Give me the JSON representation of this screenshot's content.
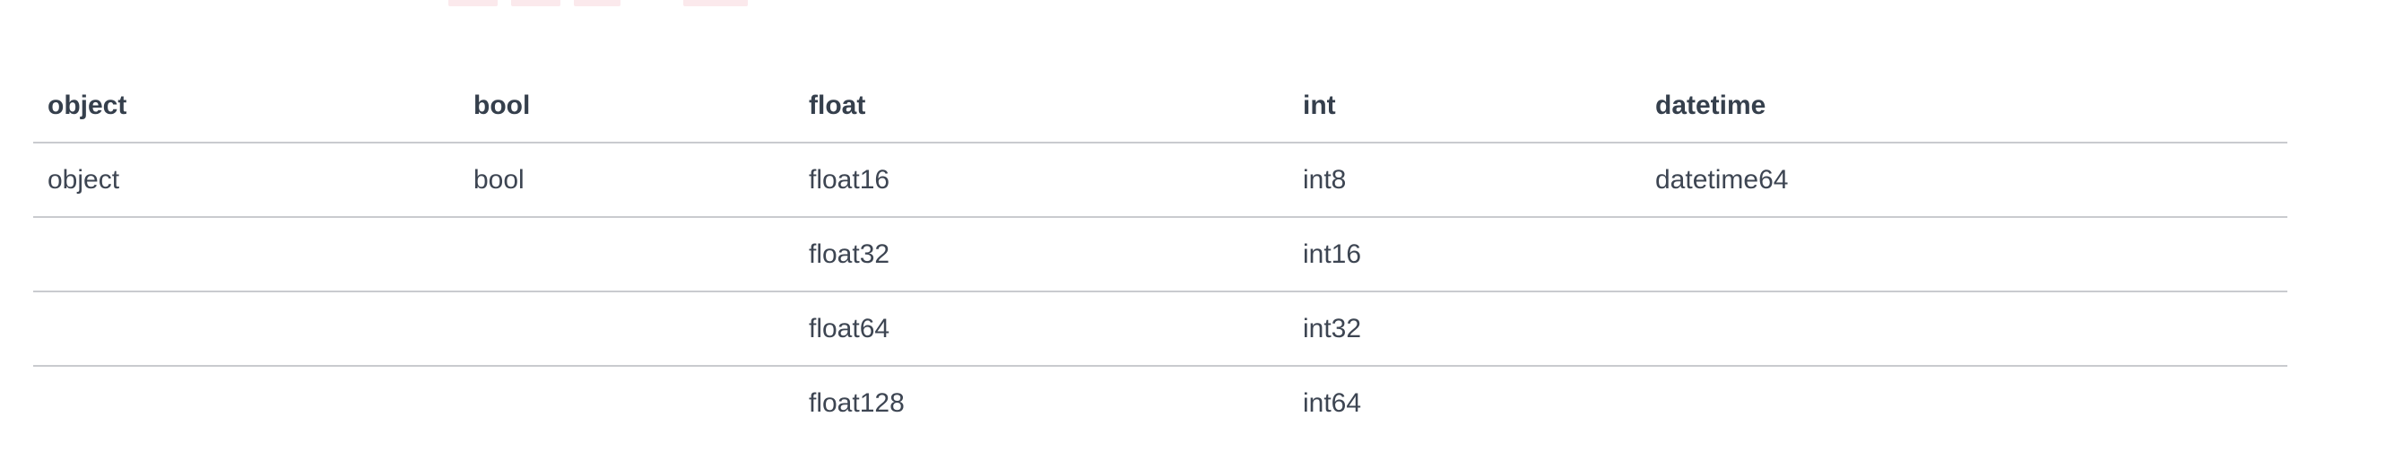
{
  "table": {
    "headers": [
      "object",
      "bool",
      "float",
      "int",
      "datetime"
    ],
    "rows": [
      [
        "object",
        "bool",
        "float16",
        "int8",
        "datetime64"
      ],
      [
        "",
        "",
        "float32",
        "int16",
        ""
      ],
      [
        "",
        "",
        "float64",
        "int32",
        ""
      ],
      [
        "",
        "",
        "float128",
        "int64",
        ""
      ]
    ]
  }
}
